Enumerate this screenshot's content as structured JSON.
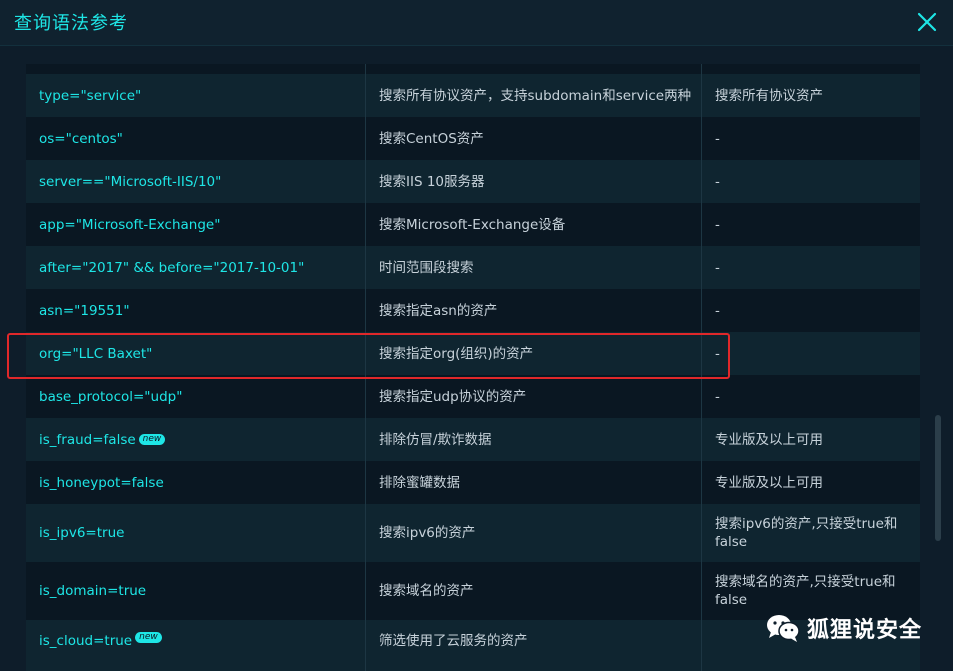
{
  "header": {
    "title": "查询语法参考"
  },
  "rows": [
    {
      "syntax": "type=\"service\"",
      "desc": "搜索所有协议资产，支持subdomain和service两种",
      "note": "搜索所有协议资产"
    },
    {
      "syntax": "os=\"centos\"",
      "desc": "搜索CentOS资产",
      "note": "-"
    },
    {
      "syntax": "server==\"Microsoft-IIS/10\"",
      "desc": "搜索IIS 10服务器",
      "note": "-"
    },
    {
      "syntax": "app=\"Microsoft-Exchange\"",
      "desc": "搜索Microsoft-Exchange设备",
      "note": "-"
    },
    {
      "syntax": "after=\"2017\" && before=\"2017-10-01\"",
      "desc": "时间范围段搜索",
      "note": "-"
    },
    {
      "syntax": "asn=\"19551\"",
      "desc": "搜索指定asn的资产",
      "note": "-"
    },
    {
      "syntax": "org=\"LLC Baxet\"",
      "desc": "搜索指定org(组织)的资产",
      "note": "-"
    },
    {
      "syntax": "base_protocol=\"udp\"",
      "desc": "搜索指定udp协议的资产",
      "note": "-"
    },
    {
      "syntax": "is_fraud=false",
      "badge": "new",
      "desc": "排除仿冒/欺诈数据",
      "note": "专业版及以上可用"
    },
    {
      "syntax": "is_honeypot=false",
      "desc": "排除蜜罐数据",
      "note": "专业版及以上可用"
    },
    {
      "syntax": "is_ipv6=true",
      "desc": "搜索ipv6的资产",
      "note": "搜索ipv6的资产,只接受true和false"
    },
    {
      "syntax": "is_domain=true",
      "desc": "搜索域名的资产",
      "note": "搜索域名的资产,只接受true和false"
    },
    {
      "syntax": "is_cloud=true",
      "badge": "new",
      "desc": "筛选使用了云服务的资产",
      "note": ""
    }
  ],
  "watermark": {
    "text": "狐狸说安全",
    "icon": "wechat-icon"
  },
  "colors": {
    "accent": "#1ee6e6",
    "highlight": "#e0282a",
    "background": "#0e1d2a"
  }
}
